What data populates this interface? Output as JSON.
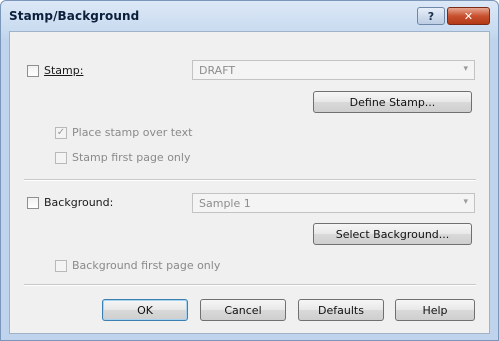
{
  "window": {
    "title": "Stamp/Background",
    "help_label": "?",
    "close_label": "✕"
  },
  "stamp": {
    "checkbox_label": "Stamp:",
    "checked": false,
    "select_value": "DRAFT",
    "define_button": "Define Stamp...",
    "place_over_text_label": "Place stamp over text",
    "place_over_text_checked": true,
    "first_page_only_label": "Stamp first page only",
    "first_page_only_checked": false
  },
  "background": {
    "checkbox_label": "Background:",
    "checked": false,
    "select_value": "Sample 1",
    "select_button": "Select Background...",
    "first_page_only_label": "Background first page only",
    "first_page_only_checked": false
  },
  "footer": {
    "ok": "OK",
    "cancel": "Cancel",
    "defaults": "Defaults",
    "help": "Help"
  },
  "icons": {
    "dropdown_arrow": "▾",
    "check_mark": "✓"
  }
}
